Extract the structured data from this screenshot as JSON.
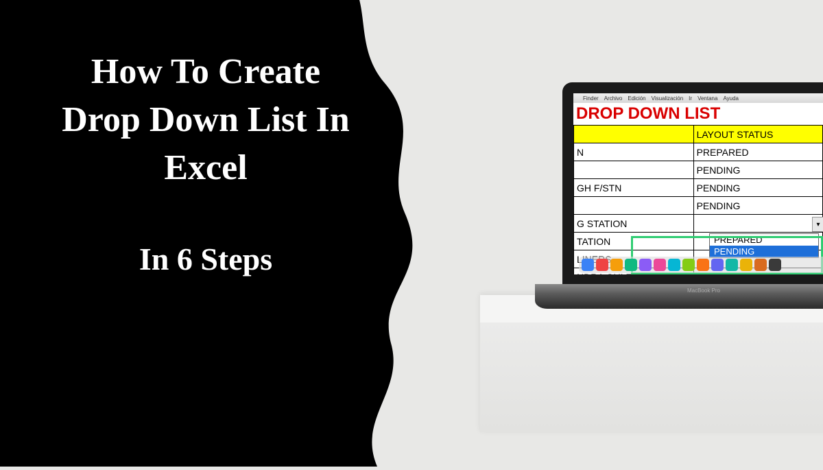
{
  "title": {
    "line1": "How To Create",
    "line2": "Drop Down List In",
    "line3": "Excel",
    "subtitle": "In 6 Steps"
  },
  "laptop": {
    "brand": "MacBook Pro",
    "menubar": {
      "apple": "",
      "items": [
        "Finder",
        "Archivo",
        "Edición",
        "Visualización",
        "Ir",
        "Ventana",
        "Ayuda"
      ]
    },
    "sheet": {
      "title": "DROP DOWN LIST",
      "header": {
        "colA": "",
        "colB": "LAYOUT STATUS"
      },
      "rows": [
        {
          "a": "N",
          "b": "PREPARED"
        },
        {
          "a": "",
          "b": "PENDING"
        },
        {
          "a": "GH F/STN",
          "b": "PENDING"
        },
        {
          "a": "",
          "b": "PENDING"
        },
        {
          "a": "G STATION",
          "b": ""
        },
        {
          "a": "TATION",
          "b": ""
        },
        {
          "a": "LINERS",
          "b": ""
        },
        {
          "a": "NDRA GULZARPORA",
          "b": ""
        }
      ],
      "dropdown": {
        "options": [
          "PREPARED",
          "PENDING"
        ],
        "selected": "PENDING"
      }
    },
    "dock_colors": [
      "#3b82f6",
      "#ef4444",
      "#f59e0b",
      "#10b981",
      "#8b5cf6",
      "#ec4899",
      "#06b6d4",
      "#84cc16",
      "#f97316",
      "#6366f1",
      "#14b8a6",
      "#eab308",
      "#d96b1f",
      "#3a3a3a"
    ]
  }
}
